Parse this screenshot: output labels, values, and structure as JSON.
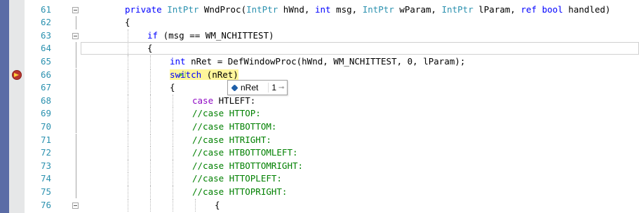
{
  "lines": [
    {
      "number": "61",
      "tokens": [
        [
          "kw",
          "private "
        ],
        [
          "ty",
          "IntPtr"
        ],
        [
          "",
          " WndProc("
        ],
        [
          "ty",
          "IntPtr"
        ],
        [
          "",
          " hWnd, "
        ],
        [
          "kw",
          "int"
        ],
        [
          "",
          " msg, "
        ],
        [
          "ty",
          "IntPtr"
        ],
        [
          "",
          " wParam, "
        ],
        [
          "ty",
          "IntPtr"
        ],
        [
          "",
          " lParam, "
        ],
        [
          "kw",
          "ref bool"
        ],
        [
          "",
          " handled)"
        ]
      ],
      "indent": 0
    },
    {
      "number": "62",
      "tokens": [
        [
          "",
          "{"
        ]
      ],
      "indent": 0
    },
    {
      "number": "63",
      "tokens": [
        [
          "kw",
          "if"
        ],
        [
          "",
          " (msg == WM_NCHITTEST)"
        ]
      ],
      "indent": 1
    },
    {
      "number": "64",
      "tokens": [
        [
          "",
          "{"
        ]
      ],
      "indent": 1
    },
    {
      "number": "65",
      "tokens": [
        [
          "kw",
          "int"
        ],
        [
          "",
          " nRet = DefWindowProc(hWnd, WM_NCHITTEST, 0, lParam);"
        ]
      ],
      "indent": 2
    },
    {
      "number": "66",
      "tokens": [
        [
          "hlkw",
          "switch"
        ],
        [
          "hl",
          " (nRet)"
        ]
      ],
      "indent": 2
    },
    {
      "number": "67",
      "tokens": [
        [
          "",
          "{"
        ]
      ],
      "indent": 2
    },
    {
      "number": "68",
      "tokens": [
        [
          "case",
          "case"
        ],
        [
          "",
          " HTLEFT:"
        ]
      ],
      "indent": 3
    },
    {
      "number": "69",
      "tokens": [
        [
          "cm",
          "//case HTTOP:"
        ]
      ],
      "indent": 3
    },
    {
      "number": "70",
      "tokens": [
        [
          "cm",
          "//case HTBOTTOM:"
        ]
      ],
      "indent": 3
    },
    {
      "number": "71",
      "tokens": [
        [
          "cm",
          "//case HTRIGHT:"
        ]
      ],
      "indent": 3
    },
    {
      "number": "72",
      "tokens": [
        [
          "cm",
          "//case HTBOTTOMLEFT:"
        ]
      ],
      "indent": 3
    },
    {
      "number": "73",
      "tokens": [
        [
          "cm",
          "//case HTBOTTOMRIGHT:"
        ]
      ],
      "indent": 3
    },
    {
      "number": "74",
      "tokens": [
        [
          "cm",
          "//case HTTOPLEFT:"
        ]
      ],
      "indent": 3
    },
    {
      "number": "75",
      "tokens": [
        [
          "cm",
          "//case HTTOPRIGHT:"
        ]
      ],
      "indent": 3
    },
    {
      "number": "76",
      "tokens": [
        [
          "",
          "{"
        ]
      ],
      "indent": 4
    }
  ],
  "fold_markers_on": [
    "61",
    "63",
    "76"
  ],
  "current_line": "66",
  "datatip": {
    "name": "nRet",
    "value": "1",
    "pin_icon": "pin-icon"
  },
  "colors": {
    "keyword": "#0000ff",
    "type": "#2b91af",
    "case_keyword": "#8f08c4",
    "comment": "#008000",
    "line_number": "#2b91af",
    "current_statement_highlight": "#fff69b"
  }
}
